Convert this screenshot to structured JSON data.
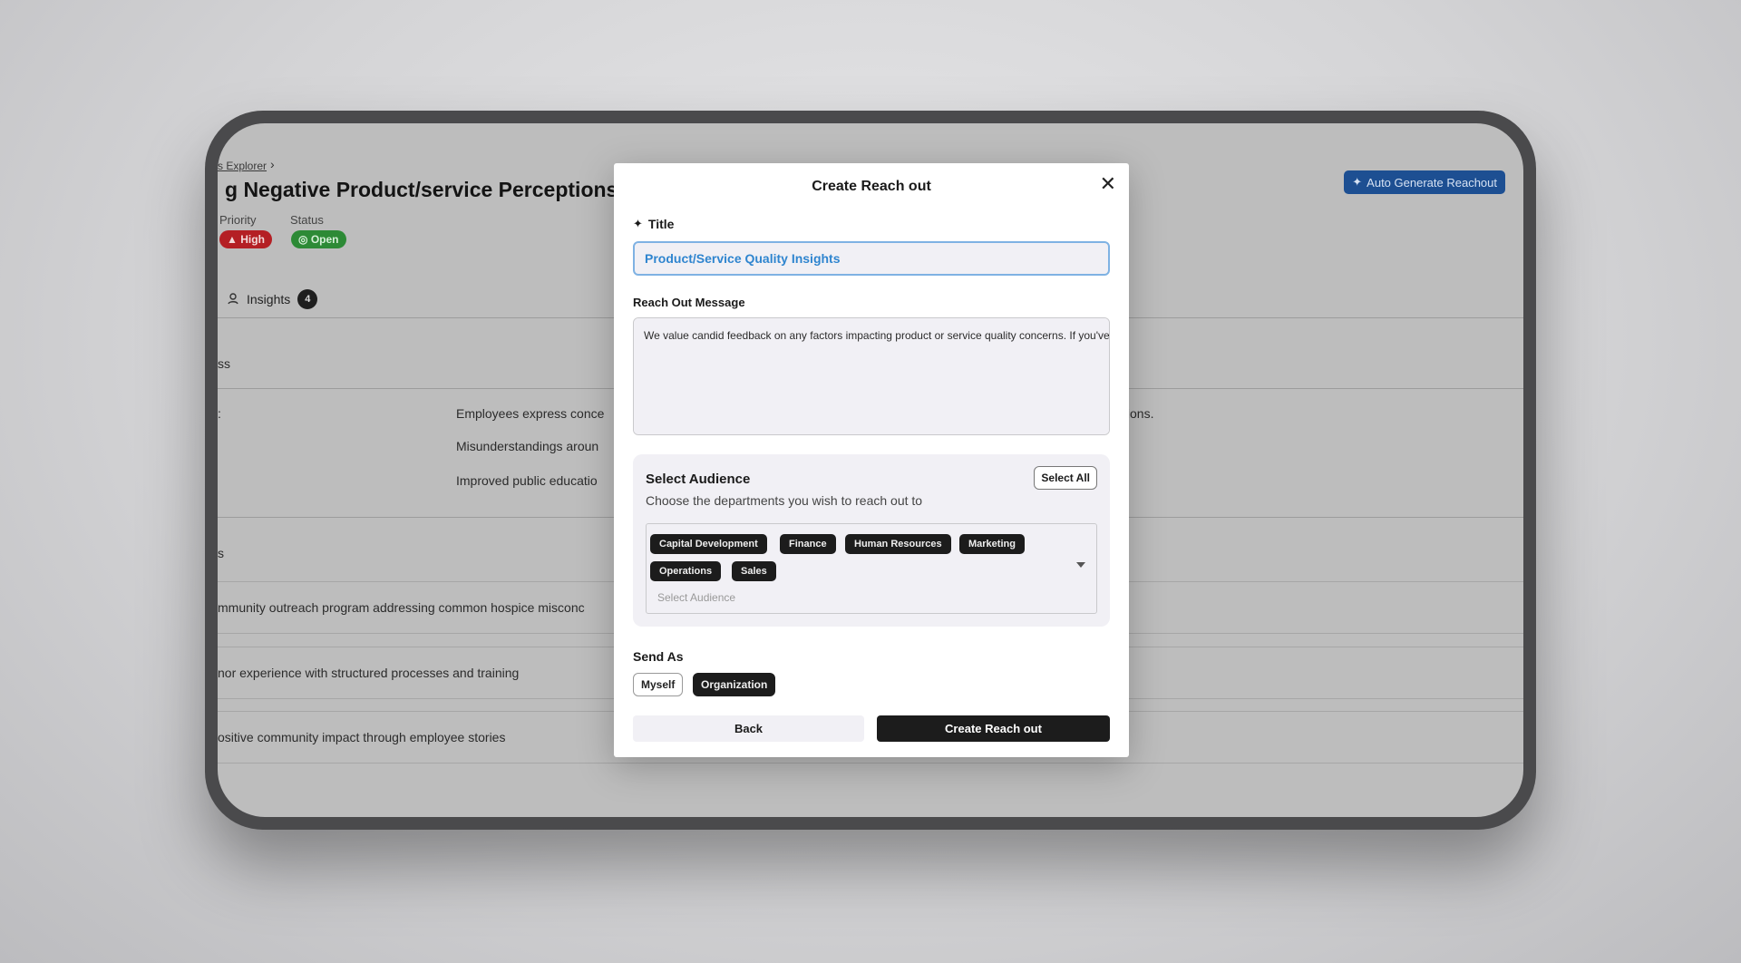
{
  "background": {
    "breadcrumb": "s Explorer",
    "page_title": "g Negative Product/service Perceptions",
    "priority_label": "Priority",
    "priority_value": "High",
    "status_label": "Status",
    "status_value": "Open",
    "tab_label": "Insights",
    "tab_count": "4",
    "auto_generate_label": "Auto Generate Reachout",
    "section_1_title": "ss",
    "row_label": ":",
    "lines": [
      "Employees express conce",
      "Misunderstandings aroun",
      "Improved public educatio",
      "tions."
    ],
    "section_2_title": "s",
    "list_items": [
      "mmunity outreach program addressing common hospice misconc",
      "nor experience with structured processes and training",
      "ositive community impact through employee stories"
    ]
  },
  "modal": {
    "title": "Create Reach out",
    "title_field_label": "Title",
    "title_value": "Product/Service Quality Insights",
    "message_label": "Reach Out Message",
    "message_value": "We value candid feedback on any factors impacting product or service quality concerns. If you've observed areas for improvement, what suggestions or insights could help us address root causes and refine our approach?",
    "audience_title": "Select Audience",
    "audience_subtitle": "Choose the departments you wish to reach out to",
    "select_all_label": "Select All",
    "selected_departments": [
      "Capital Development",
      "Finance",
      "Human Resources",
      "Marketing",
      "Operations",
      "Sales"
    ],
    "audience_placeholder": "Select Audience",
    "send_as_label": "Send As",
    "send_as_options": [
      "Myself",
      "Organization"
    ],
    "send_as_selected": "Organization",
    "back_label": "Back",
    "create_label": "Create Reach out"
  },
  "colors": {
    "accent_blue": "#2f85cf",
    "high_priority": "#b41f24",
    "open_status": "#2d8a36",
    "primary_button": "#1c1c1c"
  }
}
